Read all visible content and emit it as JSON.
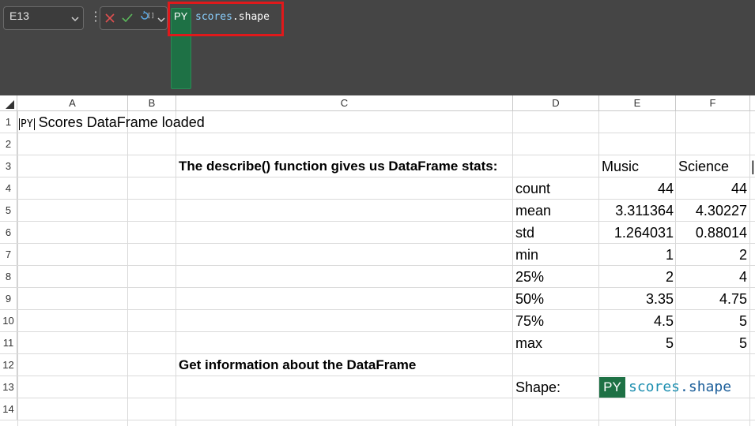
{
  "formula_bar": {
    "name_box": "E13",
    "py_badge": "PY",
    "formula_name": "scores",
    "formula_rest": ".shape"
  },
  "columns": [
    "A",
    "B",
    "C",
    "D",
    "E",
    "F"
  ],
  "rows": [
    "1",
    "2",
    "3",
    "4",
    "5",
    "6",
    "7",
    "8",
    "9",
    "10",
    "11",
    "12",
    "13",
    "14"
  ],
  "cells": {
    "a1_badge": "[PY]",
    "a1_text": "Scores DataFrame loaded",
    "c3": "The describe() function gives us DataFrame stats:",
    "e3": "Music",
    "f3": "Science",
    "stats": [
      {
        "label": "count",
        "music": "44",
        "science": "44"
      },
      {
        "label": "mean",
        "music": "3.311364",
        "science": "4.30227"
      },
      {
        "label": "std",
        "music": "1.264031",
        "science": "0.88014"
      },
      {
        "label": "min",
        "music": "1",
        "science": "2"
      },
      {
        "label": "25%",
        "music": "2",
        "science": "4"
      },
      {
        "label": "50%",
        "music": "3.35",
        "science": "4.75"
      },
      {
        "label": "75%",
        "music": "4.5",
        "science": "5"
      },
      {
        "label": "max",
        "music": "5",
        "science": "5"
      }
    ],
    "c12": "Get information about the DataFrame",
    "d13": "Shape:",
    "e13_badge": "PY",
    "e13_name": "scores",
    "e13_rest": ".shape"
  },
  "colors": {
    "python_green": "#1e7145",
    "highlight_red": "#e0191b"
  }
}
